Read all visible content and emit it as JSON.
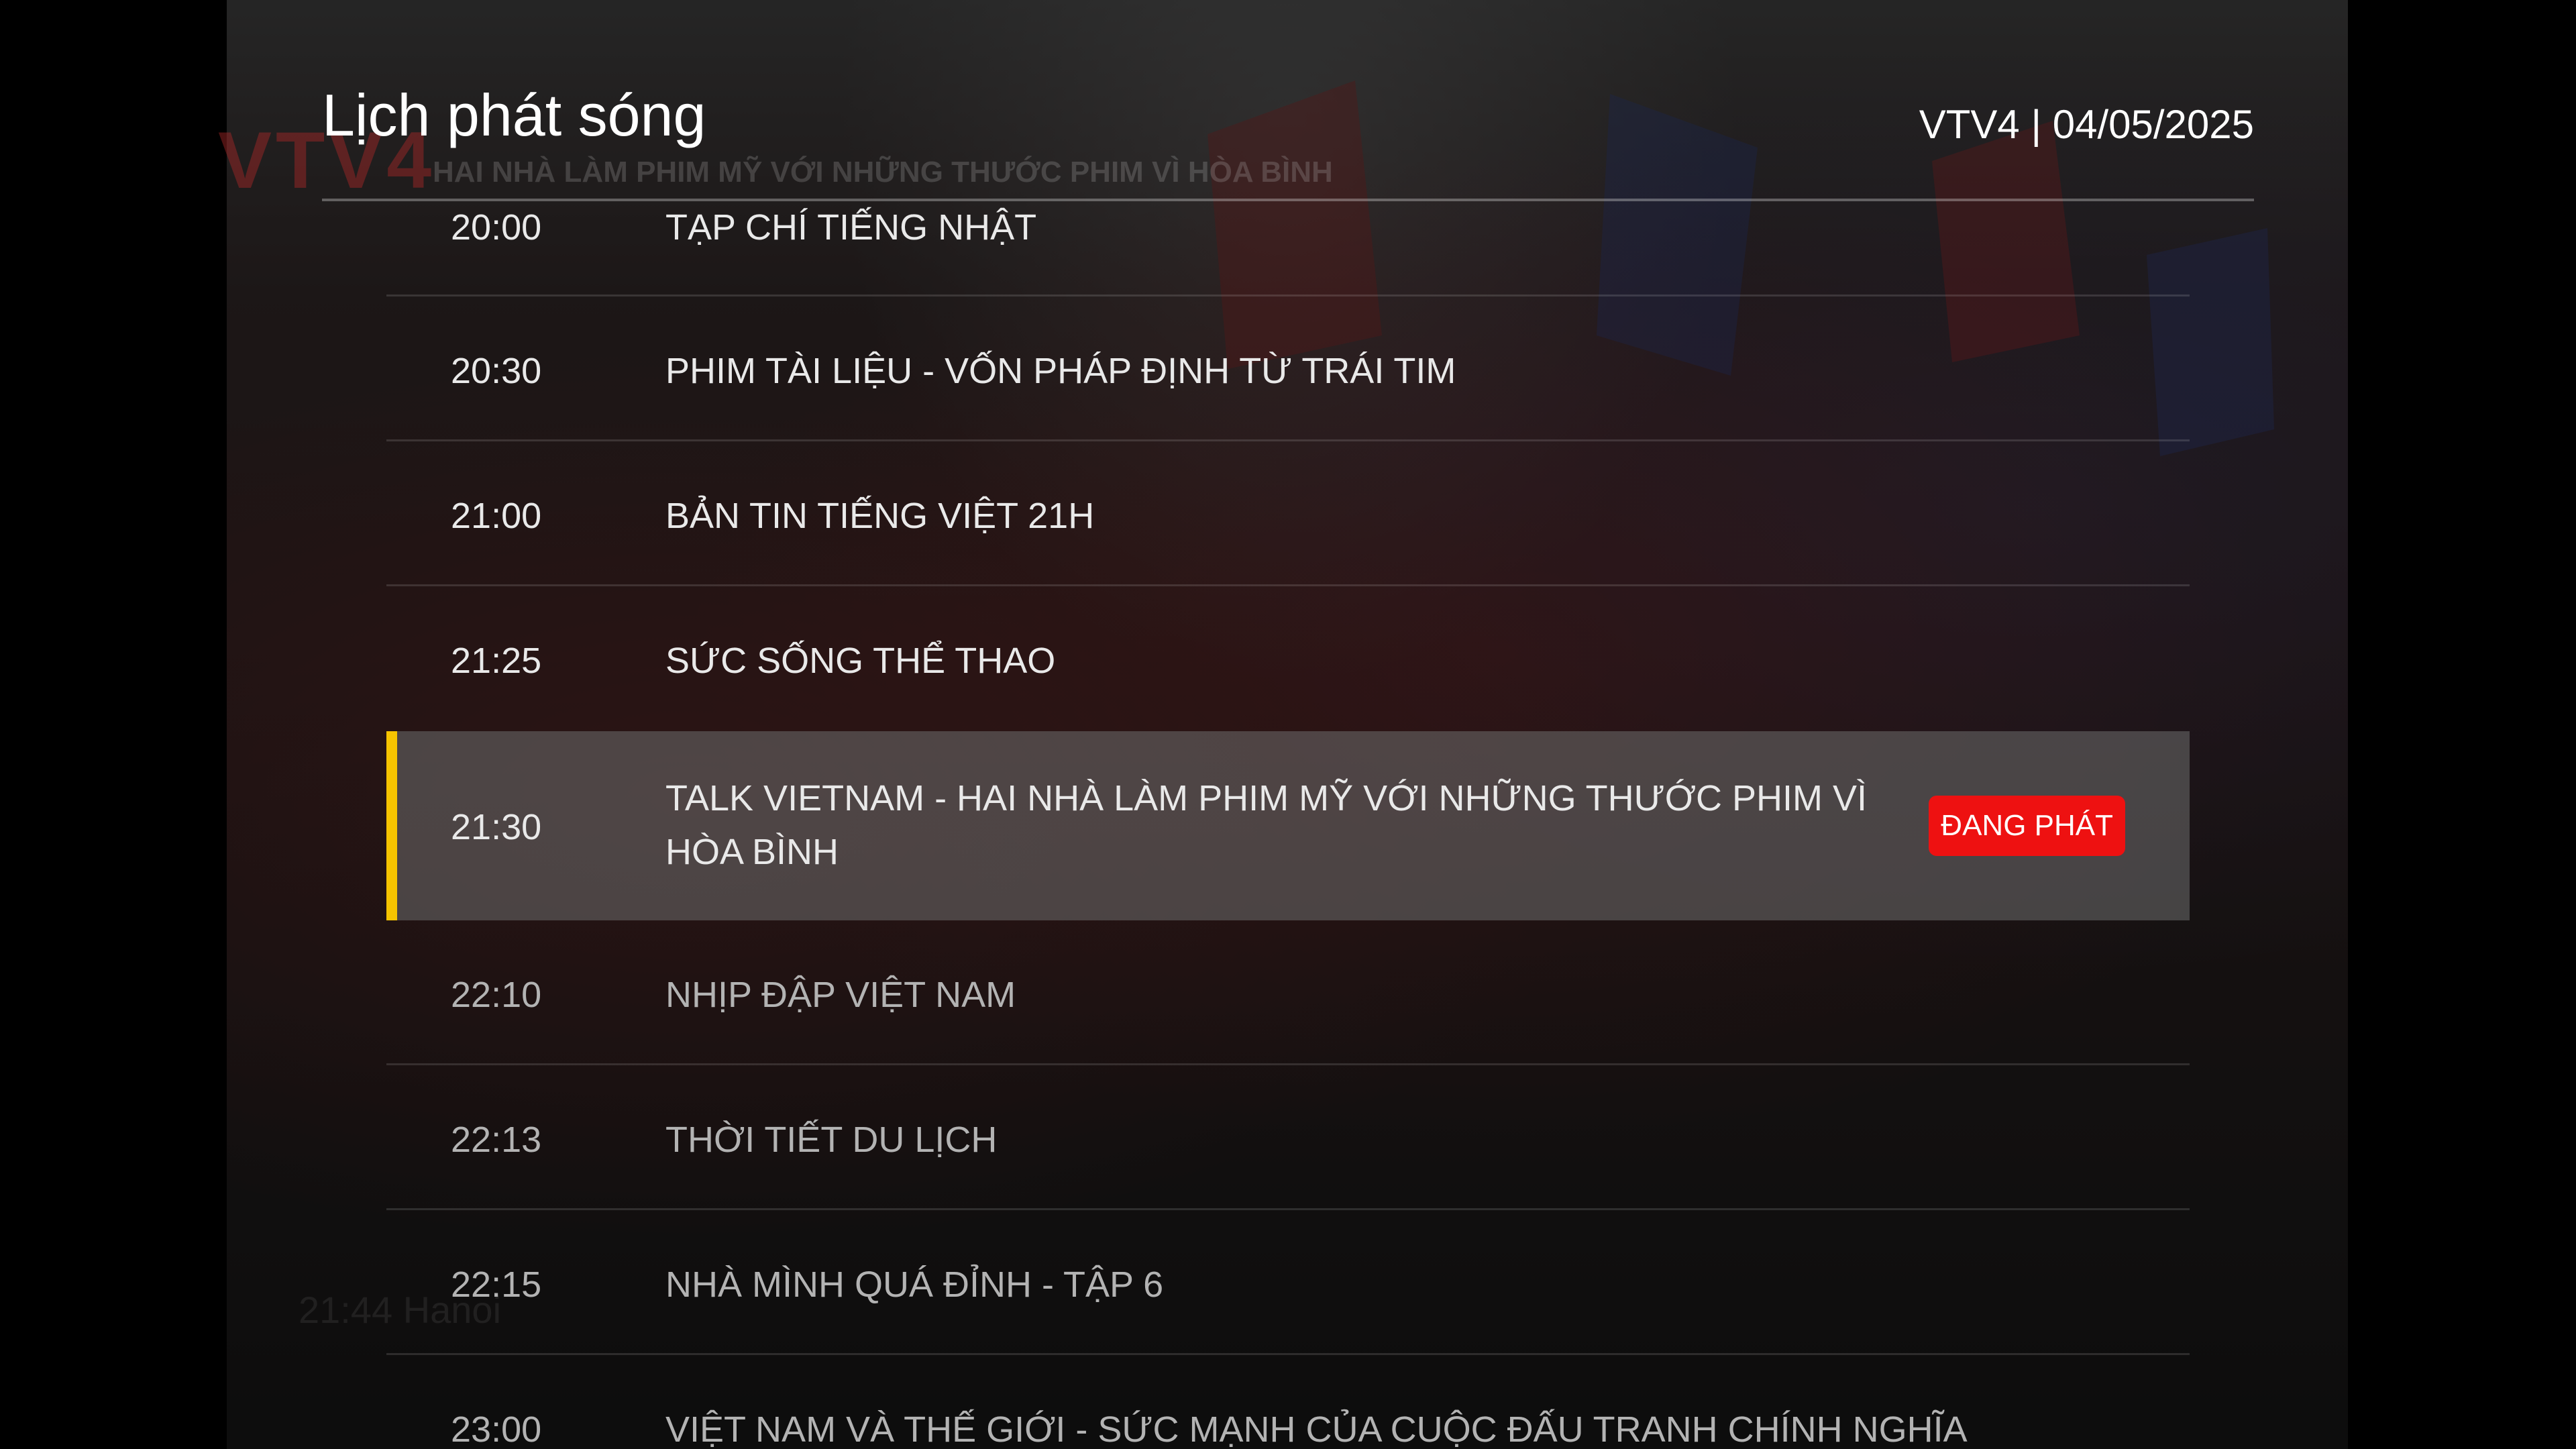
{
  "header": {
    "title": "Lịch phát sóng",
    "channel_date": "VTV4 | 04/05/2025"
  },
  "background": {
    "logo_text": "VTV4",
    "caption_text": "HAI NHÀ LÀM PHIM MỸ VỚI NHỮNG THƯỚC PHIM VÌ HÒA BÌNH",
    "clock_text": "21:44 Hanoi"
  },
  "schedule": [
    {
      "time": "20:00",
      "program": "TẠP CHÍ TIẾNG NHẬT",
      "state": "past"
    },
    {
      "time": "20:30",
      "program": "PHIM TÀI LIỆU - VỐN PHÁP ĐỊNH TỪ TRÁI TIM",
      "state": "past"
    },
    {
      "time": "21:00",
      "program": "BẢN TIN TIẾNG VIỆT 21H",
      "state": "past"
    },
    {
      "time": "21:25",
      "program": "SỨC SỐNG THỂ THAO",
      "state": "past"
    },
    {
      "time": "21:30",
      "program": "TALK VIETNAM - HAI NHÀ LÀM PHIM MỸ VỚI NHỮNG THƯỚC PHIM VÌ HÒA BÌNH",
      "state": "current",
      "badge": "ĐANG PHÁT"
    },
    {
      "time": "22:10",
      "program": "NHỊP ĐẬP VIỆT NAM",
      "state": "future"
    },
    {
      "time": "22:13",
      "program": "THỜI TIẾT DU LỊCH",
      "state": "future"
    },
    {
      "time": "22:15",
      "program": "NHÀ MÌNH QUÁ ĐỈNH - TẬP 6",
      "state": "future"
    },
    {
      "time": "23:00",
      "program": "VIỆT NAM VÀ THẾ GIỚI - SỨC MẠNH CỦA CUỘC ĐẤU TRANH CHÍNH NGHĨA",
      "state": "future"
    }
  ],
  "colors": {
    "accent": "#f6c400",
    "live_badge": "#ee1111",
    "text": "#ffffff"
  }
}
